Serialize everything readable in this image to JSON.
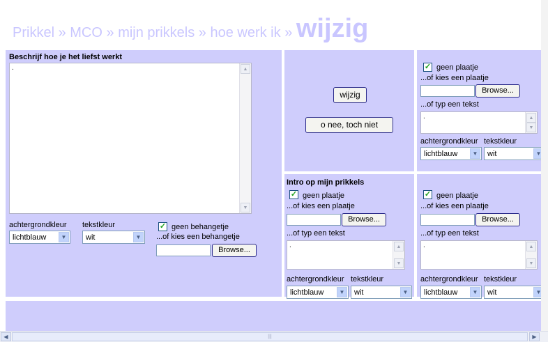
{
  "breadcrumb": {
    "items": [
      "Prikkel",
      "MCO",
      "mijn prikkels",
      "hoe werk ik"
    ],
    "separator": "»",
    "current": "wijzig"
  },
  "main_panel": {
    "title": "Beschrijf hoe je het liefst werkt",
    "textarea_value": ".",
    "bgcolor_label": "achtergrondkleur",
    "bgcolor_value": "lichtblauw",
    "textcolor_label": "tekstkleur",
    "textcolor_value": "wit",
    "no_wallpaper_label": "geen behangetje",
    "choose_wallpaper_label": "...of kies een behangetje",
    "browse_label": "Browse..."
  },
  "actions": {
    "change_label": "wijzig",
    "cancel_label": "o nee, toch niet"
  },
  "card_top_right": {
    "no_image_label": "geen plaatje",
    "choose_image_label": "...of kies een plaatje",
    "browse_label": "Browse...",
    "type_text_label": "...of typ een tekst",
    "textarea_value": ".",
    "bgcolor_label": "achtergrondkleur",
    "bgcolor_value": "lichtblauw",
    "textcolor_label": "tekstkleur",
    "textcolor_value": "wit"
  },
  "card_intro": {
    "title": "Intro op mijn prikkels",
    "no_image_label": "geen plaatje",
    "choose_image_label": "...of kies een plaatje",
    "browse_label": "Browse...",
    "type_text_label": "...of typ een tekst",
    "textarea_value": ".",
    "bgcolor_label": "achtergrondkleur",
    "bgcolor_value": "lichtblauw",
    "textcolor_label": "tekstkleur",
    "textcolor_value": "wit"
  },
  "card_bottom_right": {
    "no_image_label": "geen plaatje",
    "choose_image_label": "...of kies een plaatje",
    "browse_label": "Browse...",
    "type_text_label": "...of typ een tekst",
    "textarea_value": ".",
    "bgcolor_label": "achtergrondkleur",
    "bgcolor_value": "lichtblauw",
    "textcolor_label": "tekstkleur",
    "textcolor_value": "wit"
  },
  "colors": {
    "panel": "#cfcdfc",
    "header_text": "#c9c6ff",
    "check": "#21a121"
  },
  "icons": {
    "check": "checkmark-icon",
    "select_arrow": "chevron-down-icon",
    "scroll_up": "arrow-up-icon",
    "scroll_down": "arrow-down-icon"
  }
}
